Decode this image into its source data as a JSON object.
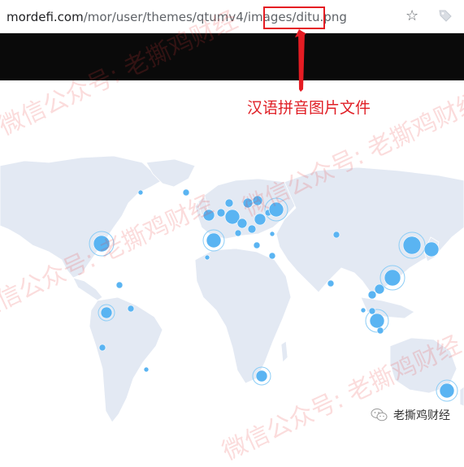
{
  "browser": {
    "url_host": "mordefi.com",
    "url_path": "/mor/user/themes/qtumv4/images/ditu.png",
    "star_icon": "star-icon",
    "extension_icon": "extension-tag-icon"
  },
  "annotation": {
    "text": "汉语拼音图片文件",
    "color": "#e01f26"
  },
  "map": {
    "land_color": "#e3e9f3",
    "bubble_color": "#5ab4f2"
  },
  "watermark": {
    "text": "微信公众号: 老撕鸡财经"
  },
  "badge": {
    "icon": "wechat-icon",
    "label": "老撕鸡财经"
  }
}
